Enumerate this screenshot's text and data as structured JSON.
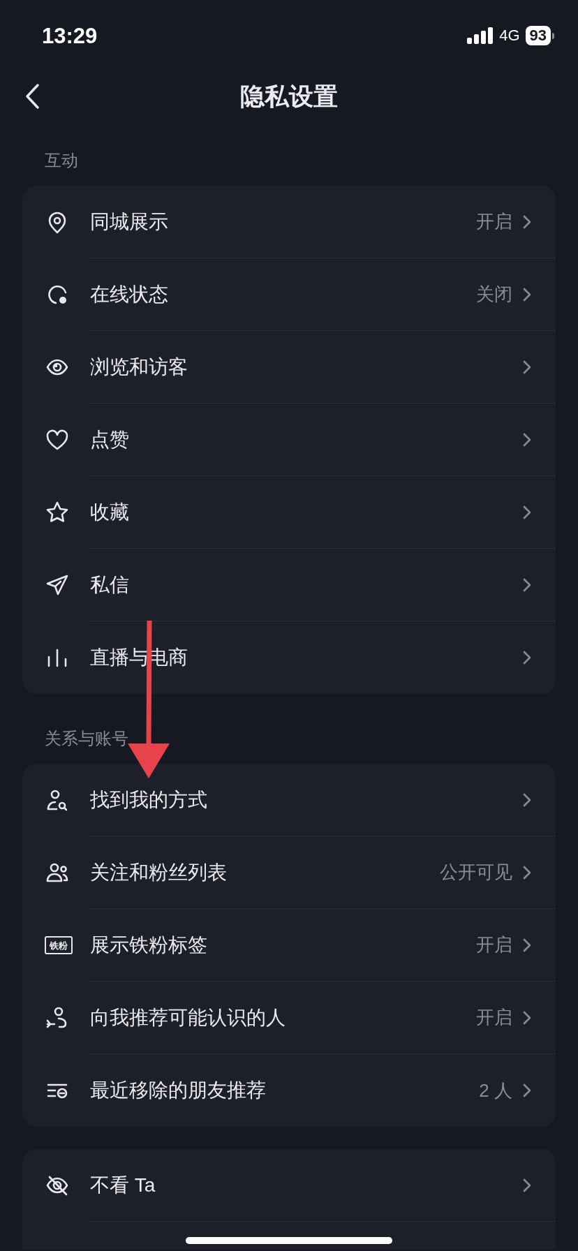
{
  "status_bar": {
    "time": "13:29",
    "network": "4G",
    "battery": "93"
  },
  "header": {
    "title": "隐私设置"
  },
  "sections": [
    {
      "title": "互动",
      "items": [
        {
          "kind": "location",
          "label": "同城展示",
          "value": "开启"
        },
        {
          "kind": "online",
          "label": "在线状态",
          "value": "关闭"
        },
        {
          "kind": "eye",
          "label": "浏览和访客"
        },
        {
          "kind": "heart",
          "label": "点赞"
        },
        {
          "kind": "star",
          "label": "收藏"
        },
        {
          "kind": "send",
          "label": "私信"
        },
        {
          "kind": "bars",
          "label": "直播与电商"
        }
      ]
    },
    {
      "title": "关系与账号",
      "items": [
        {
          "kind": "person-search",
          "label": "找到我的方式"
        },
        {
          "kind": "people",
          "label": "关注和粉丝列表",
          "value": "公开可见"
        },
        {
          "kind": "badge",
          "icon_text": "铁粉",
          "label": "展示铁粉标签",
          "value": "开启"
        },
        {
          "kind": "recommend",
          "label": "向我推荐可能认识的人",
          "value": "开启"
        },
        {
          "kind": "list-remove",
          "label": "最近移除的朋友推荐",
          "value": "2 人"
        }
      ]
    },
    {
      "items": [
        {
          "kind": "eye-off",
          "label": "不看 Ta"
        }
      ]
    }
  ]
}
